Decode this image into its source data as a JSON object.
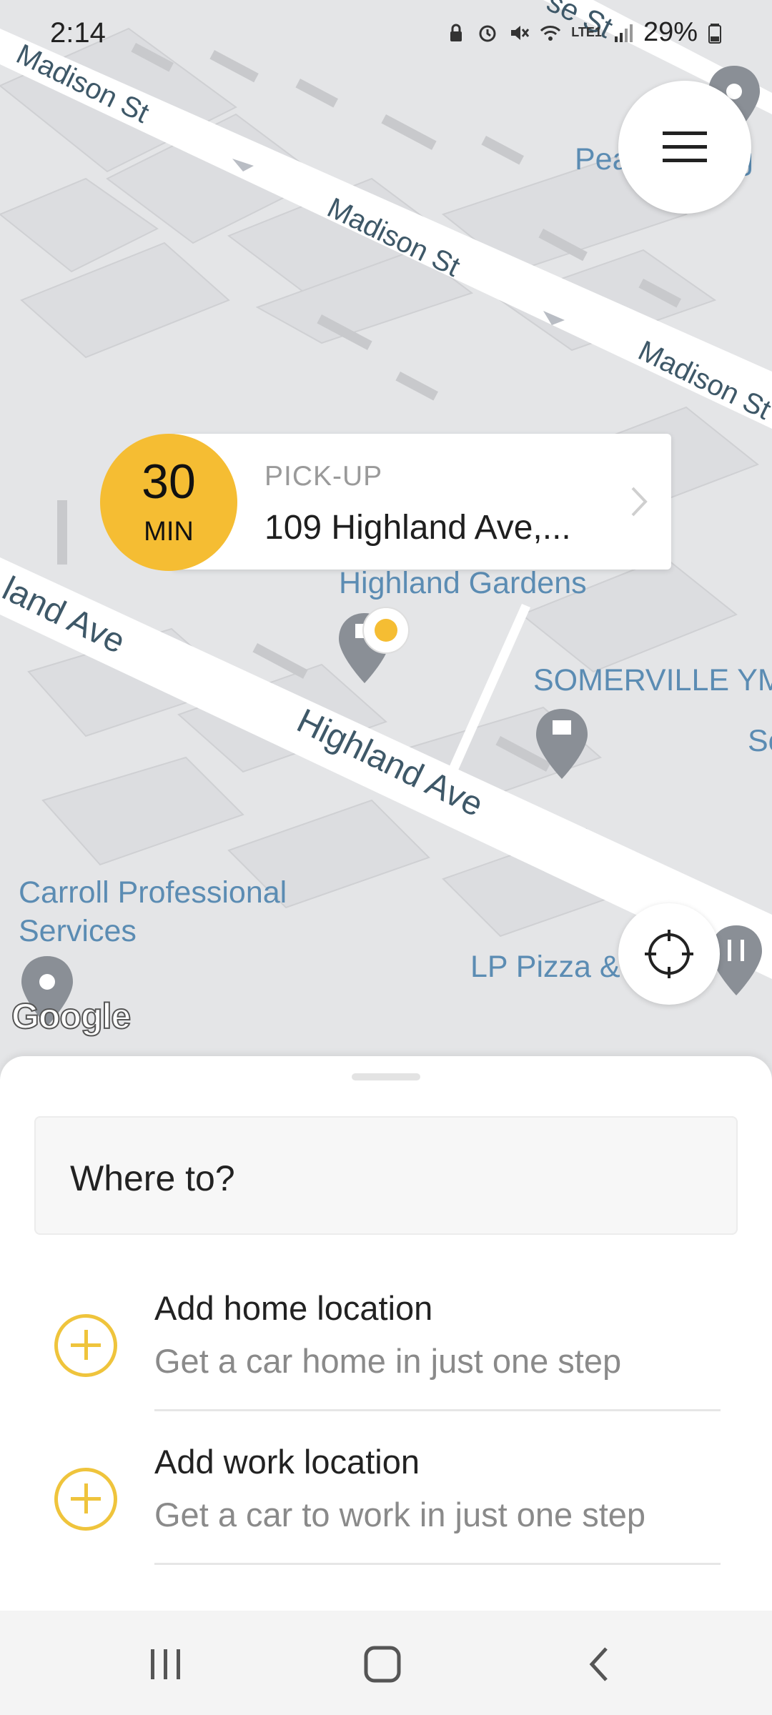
{
  "status_bar": {
    "time": "2:14",
    "battery": "29%",
    "network": "LTE1"
  },
  "map": {
    "streets": {
      "madison_1": "Madison St",
      "madison_2": "Madison St",
      "madison_3": "Madison St",
      "highland_1": "land Ave",
      "highland_2": "Highland Ave",
      "top_fragment": "se St"
    },
    "pois": {
      "highland_gardens": "Highland Gardens",
      "somerville": "SOMERVILLE YM",
      "carroll_1": "Carroll Professional",
      "carroll_2": "Services",
      "lp_pizza": "LP Pizza &",
      "pea": "Pea",
      "sing": "sing",
      "so": "So"
    },
    "google_logo": "Google"
  },
  "pickup": {
    "eta_value": "30",
    "eta_unit": "MIN",
    "label": "PICK-UP",
    "address": "109 Highland Ave,..."
  },
  "sheet": {
    "search_placeholder": "Where to?",
    "rows": [
      {
        "title": "Add home location",
        "subtitle": "Get a car home in just one step"
      },
      {
        "title": "Add work location",
        "subtitle": "Get a car to work in just one step"
      }
    ]
  },
  "colors": {
    "accent": "#f5bd33",
    "map_bg": "#e4e5e7",
    "road": "#ffffff",
    "poi_text": "#5b8cb3"
  },
  "icons": {
    "menu": "hamburger-icon",
    "locate": "crosshair-icon",
    "chevron": "chevron-right-icon",
    "plus": "plus-circle-icon"
  }
}
